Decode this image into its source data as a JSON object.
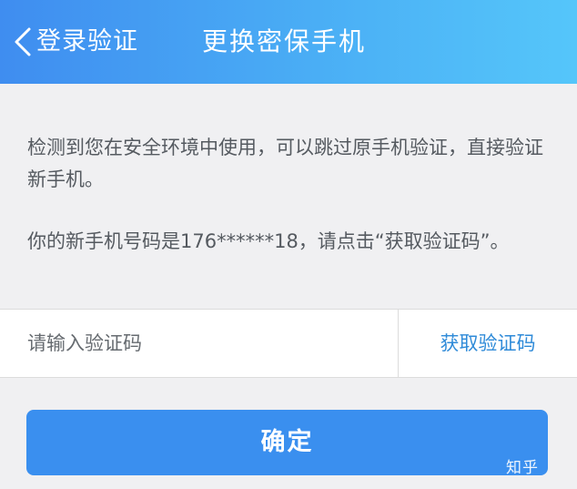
{
  "header": {
    "back_label": "登录验证",
    "title": "更换密保手机"
  },
  "notice": {
    "line1": "检测到您在安全环境中使用，可以跳过原手机验证，直接验证新手机。",
    "line2": "你的新手机号码是176******18，请点击“获取验证码”。"
  },
  "code_row": {
    "placeholder": "请输入验证码",
    "get_code_label": "获取验证码"
  },
  "confirm": {
    "label": "确定"
  },
  "watermark": {
    "text": "知乎"
  },
  "colors": {
    "header_start": "#3f8df0",
    "header_end": "#55c6fa",
    "accent": "#3a8fef",
    "link": "#2e8ad8",
    "background": "#f0f0f2"
  }
}
